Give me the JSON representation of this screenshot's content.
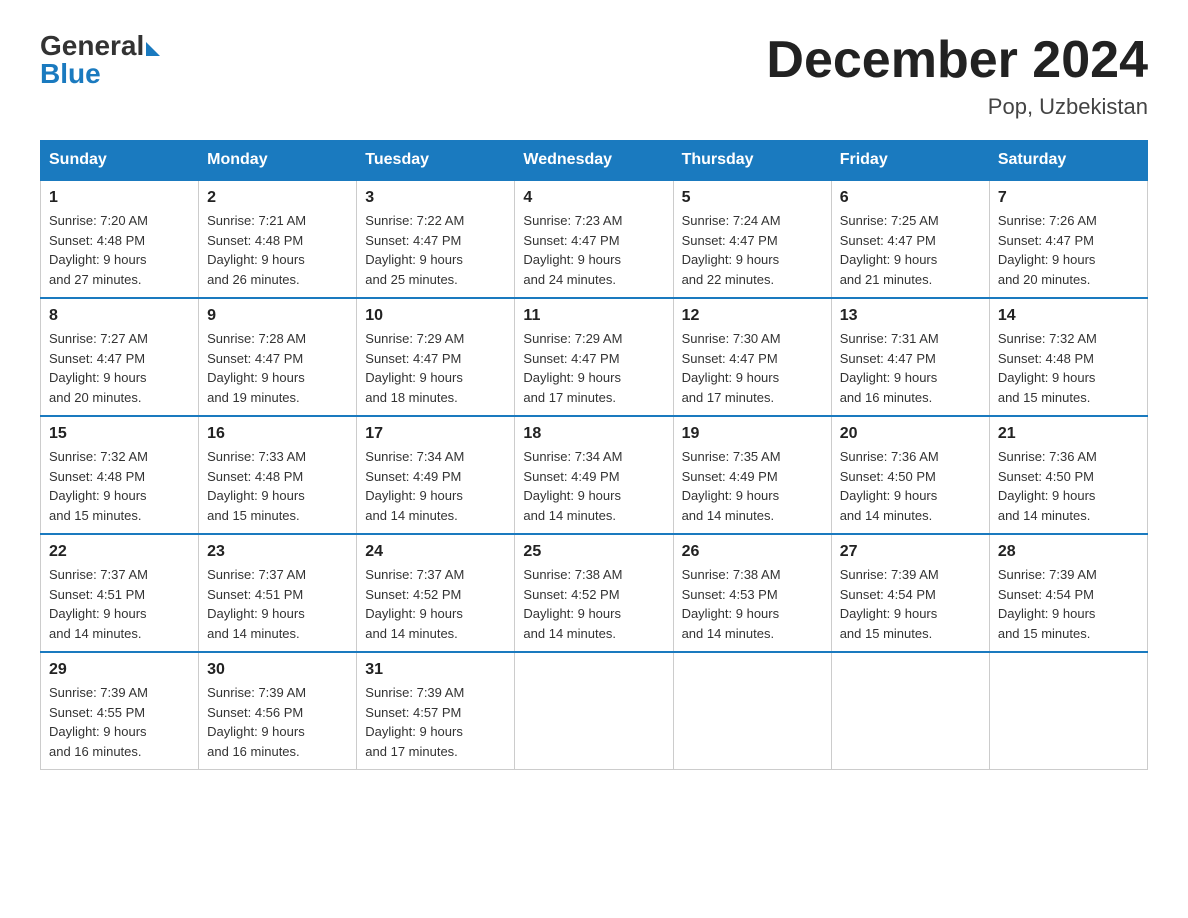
{
  "header": {
    "logo_general": "General",
    "logo_blue": "Blue",
    "month_title": "December 2024",
    "location": "Pop, Uzbekistan"
  },
  "days_of_week": [
    "Sunday",
    "Monday",
    "Tuesday",
    "Wednesday",
    "Thursday",
    "Friday",
    "Saturday"
  ],
  "weeks": [
    [
      {
        "day": "1",
        "sunrise": "7:20 AM",
        "sunset": "4:48 PM",
        "daylight": "9 hours and 27 minutes."
      },
      {
        "day": "2",
        "sunrise": "7:21 AM",
        "sunset": "4:48 PM",
        "daylight": "9 hours and 26 minutes."
      },
      {
        "day": "3",
        "sunrise": "7:22 AM",
        "sunset": "4:47 PM",
        "daylight": "9 hours and 25 minutes."
      },
      {
        "day": "4",
        "sunrise": "7:23 AM",
        "sunset": "4:47 PM",
        "daylight": "9 hours and 24 minutes."
      },
      {
        "day": "5",
        "sunrise": "7:24 AM",
        "sunset": "4:47 PM",
        "daylight": "9 hours and 22 minutes."
      },
      {
        "day": "6",
        "sunrise": "7:25 AM",
        "sunset": "4:47 PM",
        "daylight": "9 hours and 21 minutes."
      },
      {
        "day": "7",
        "sunrise": "7:26 AM",
        "sunset": "4:47 PM",
        "daylight": "9 hours and 20 minutes."
      }
    ],
    [
      {
        "day": "8",
        "sunrise": "7:27 AM",
        "sunset": "4:47 PM",
        "daylight": "9 hours and 20 minutes."
      },
      {
        "day": "9",
        "sunrise": "7:28 AM",
        "sunset": "4:47 PM",
        "daylight": "9 hours and 19 minutes."
      },
      {
        "day": "10",
        "sunrise": "7:29 AM",
        "sunset": "4:47 PM",
        "daylight": "9 hours and 18 minutes."
      },
      {
        "day": "11",
        "sunrise": "7:29 AM",
        "sunset": "4:47 PM",
        "daylight": "9 hours and 17 minutes."
      },
      {
        "day": "12",
        "sunrise": "7:30 AM",
        "sunset": "4:47 PM",
        "daylight": "9 hours and 17 minutes."
      },
      {
        "day": "13",
        "sunrise": "7:31 AM",
        "sunset": "4:47 PM",
        "daylight": "9 hours and 16 minutes."
      },
      {
        "day": "14",
        "sunrise": "7:32 AM",
        "sunset": "4:48 PM",
        "daylight": "9 hours and 15 minutes."
      }
    ],
    [
      {
        "day": "15",
        "sunrise": "7:32 AM",
        "sunset": "4:48 PM",
        "daylight": "9 hours and 15 minutes."
      },
      {
        "day": "16",
        "sunrise": "7:33 AM",
        "sunset": "4:48 PM",
        "daylight": "9 hours and 15 minutes."
      },
      {
        "day": "17",
        "sunrise": "7:34 AM",
        "sunset": "4:49 PM",
        "daylight": "9 hours and 14 minutes."
      },
      {
        "day": "18",
        "sunrise": "7:34 AM",
        "sunset": "4:49 PM",
        "daylight": "9 hours and 14 minutes."
      },
      {
        "day": "19",
        "sunrise": "7:35 AM",
        "sunset": "4:49 PM",
        "daylight": "9 hours and 14 minutes."
      },
      {
        "day": "20",
        "sunrise": "7:36 AM",
        "sunset": "4:50 PM",
        "daylight": "9 hours and 14 minutes."
      },
      {
        "day": "21",
        "sunrise": "7:36 AM",
        "sunset": "4:50 PM",
        "daylight": "9 hours and 14 minutes."
      }
    ],
    [
      {
        "day": "22",
        "sunrise": "7:37 AM",
        "sunset": "4:51 PM",
        "daylight": "9 hours and 14 minutes."
      },
      {
        "day": "23",
        "sunrise": "7:37 AM",
        "sunset": "4:51 PM",
        "daylight": "9 hours and 14 minutes."
      },
      {
        "day": "24",
        "sunrise": "7:37 AM",
        "sunset": "4:52 PM",
        "daylight": "9 hours and 14 minutes."
      },
      {
        "day": "25",
        "sunrise": "7:38 AM",
        "sunset": "4:52 PM",
        "daylight": "9 hours and 14 minutes."
      },
      {
        "day": "26",
        "sunrise": "7:38 AM",
        "sunset": "4:53 PM",
        "daylight": "9 hours and 14 minutes."
      },
      {
        "day": "27",
        "sunrise": "7:39 AM",
        "sunset": "4:54 PM",
        "daylight": "9 hours and 15 minutes."
      },
      {
        "day": "28",
        "sunrise": "7:39 AM",
        "sunset": "4:54 PM",
        "daylight": "9 hours and 15 minutes."
      }
    ],
    [
      {
        "day": "29",
        "sunrise": "7:39 AM",
        "sunset": "4:55 PM",
        "daylight": "9 hours and 16 minutes."
      },
      {
        "day": "30",
        "sunrise": "7:39 AM",
        "sunset": "4:56 PM",
        "daylight": "9 hours and 16 minutes."
      },
      {
        "day": "31",
        "sunrise": "7:39 AM",
        "sunset": "4:57 PM",
        "daylight": "9 hours and 17 minutes."
      },
      null,
      null,
      null,
      null
    ]
  ],
  "labels": {
    "sunrise": "Sunrise:",
    "sunset": "Sunset:",
    "daylight": "Daylight:"
  }
}
